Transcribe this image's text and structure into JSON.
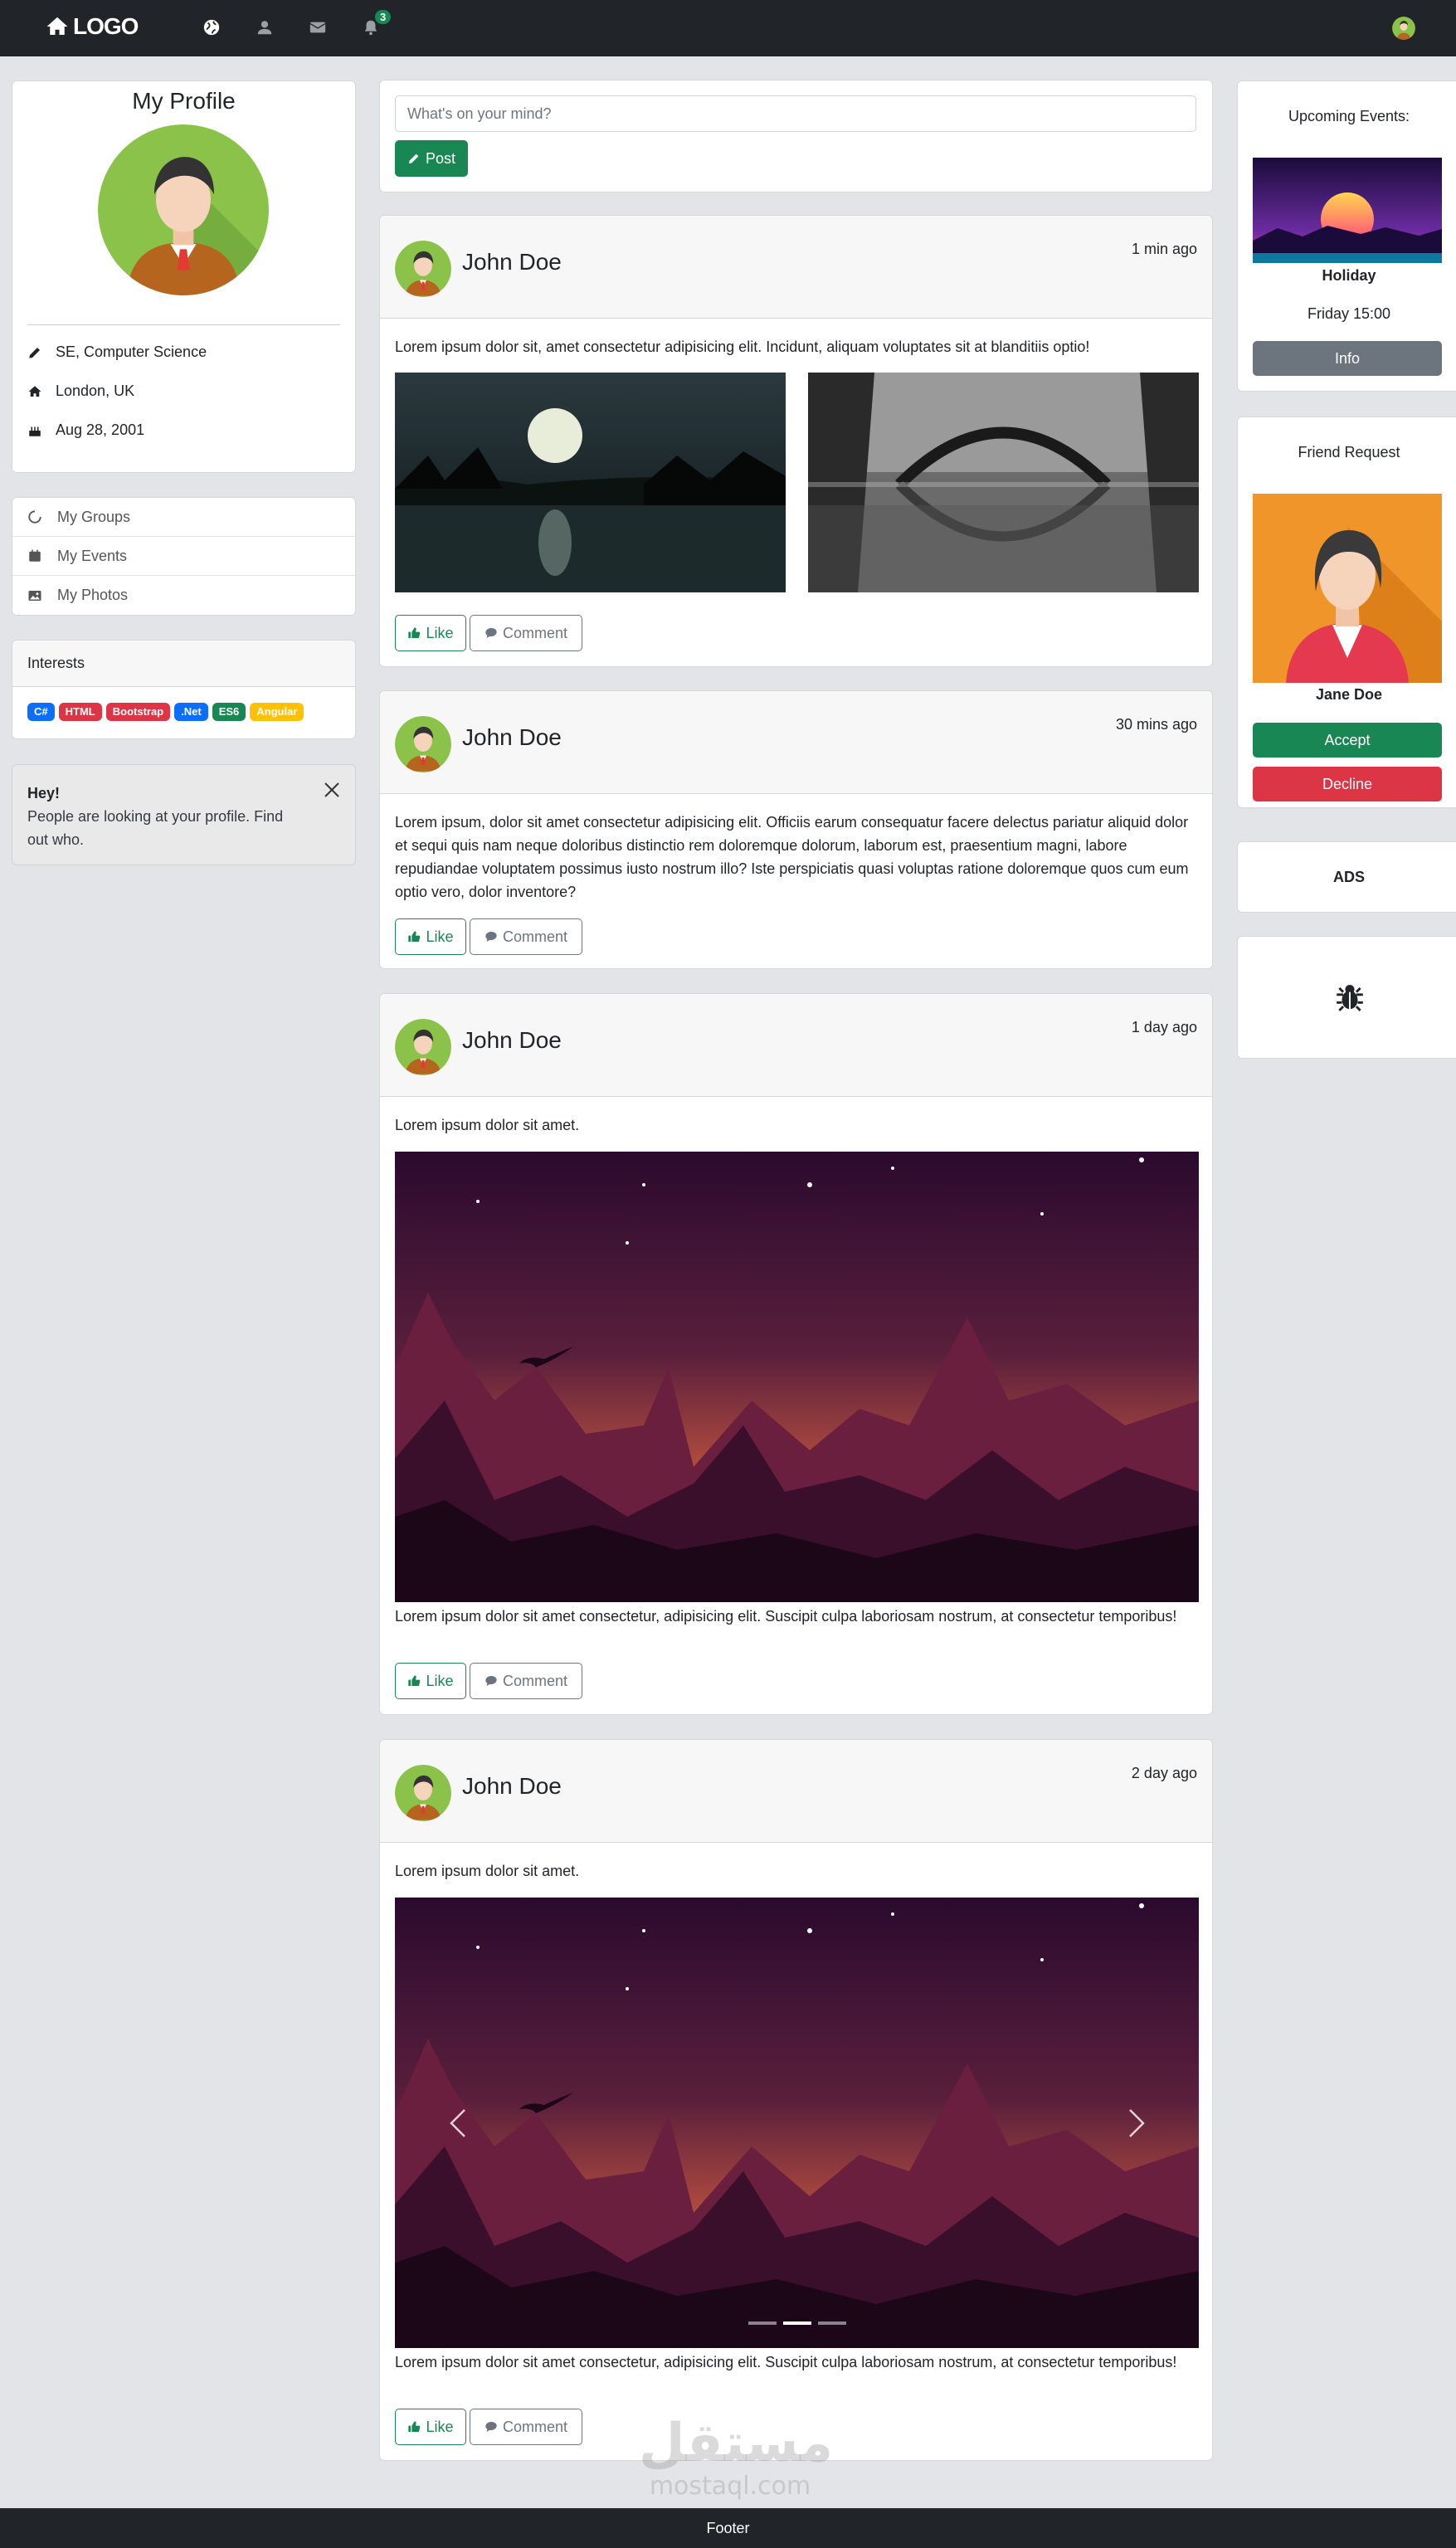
{
  "navbar": {
    "brand": "LOGO",
    "notification_count": "3",
    "icons": [
      "globe-icon",
      "user-icon",
      "envelope-icon",
      "bell-icon"
    ]
  },
  "profile": {
    "title": "My Profile",
    "occupation": "SE, Computer Science",
    "location": "London, UK",
    "birthday": "Aug 28, 2001"
  },
  "links": [
    {
      "label": "My Groups",
      "icon": "circle-notch-icon"
    },
    {
      "label": "My Events",
      "icon": "calendar-icon"
    },
    {
      "label": "My Photos",
      "icon": "image-icon"
    }
  ],
  "interests": {
    "title": "Interests",
    "tags": [
      {
        "label": "C#",
        "color": "#0d6efd"
      },
      {
        "label": "HTML",
        "color": "#dc3545"
      },
      {
        "label": "Bootstrap",
        "color": "#dc3545"
      },
      {
        "label": ".Net",
        "color": "#0d6efd"
      },
      {
        "label": "ES6",
        "color": "#198754"
      },
      {
        "label": "Angular",
        "color": "#ffc107"
      }
    ]
  },
  "alert": {
    "title": "Hey!",
    "message": "People are looking at your profile. Find out who."
  },
  "composer": {
    "placeholder": "What's on your mind?",
    "post_label": "Post"
  },
  "posts": [
    {
      "author": "John Doe",
      "time": "1 min ago",
      "text": "Lorem ipsum dolor sit, amet consectetur adipisicing elit. Incidunt, aliquam voluptates sit at blanditiis optio!",
      "like_label": "Like",
      "comment_label": "Comment"
    },
    {
      "author": "John Doe",
      "time": "30 mins ago",
      "text": "Lorem ipsum, dolor sit amet consectetur adipisicing elit. Officiis earum consequatur facere delectus pariatur aliquid dolor et sequi quis nam neque doloribus distinctio rem doloremque dolorum, laborum est, praesentium magni, labore repudiandae voluptatem possimus iusto nostrum illo? Iste perspiciatis quasi voluptas ratione doloremque quos cum eum optio vero, dolor inventore?",
      "like_label": "Like",
      "comment_label": "Comment"
    },
    {
      "author": "John Doe",
      "time": "1 day ago",
      "text": "Lorem ipsum dolor sit amet.",
      "caption": "Lorem ipsum dolor sit amet consectetur, adipisicing elit. Suscipit culpa laboriosam nostrum, at consectetur temporibus!",
      "like_label": "Like",
      "comment_label": "Comment"
    },
    {
      "author": "John Doe",
      "time": "2 day ago",
      "text": "Lorem ipsum dolor sit amet.",
      "caption": "Lorem ipsum dolor sit amet consectetur, adipisicing elit. Suscipit culpa laboriosam nostrum, at consectetur temporibus!",
      "like_label": "Like",
      "comment_label": "Comment",
      "carousel": {
        "slides": 3,
        "active": 2
      }
    }
  ],
  "events": {
    "title": "Upcoming Events:",
    "name": "Holiday",
    "time": "Friday 15:00",
    "button": "Info"
  },
  "friend_request": {
    "title": "Friend Request",
    "name": "Jane Doe",
    "accept": "Accept",
    "decline": "Decline"
  },
  "ads": {
    "label": "ADS",
    "icon": "bug-icon"
  },
  "footer": {
    "label": "Footer"
  },
  "watermark": {
    "arabic": "مستقل",
    "latin": "mostaql.com"
  },
  "colors": {
    "navbar": "#212529",
    "success": "#198754",
    "danger": "#dc3545",
    "secondary": "#6c757d",
    "page_bg": "#e3e4e8"
  }
}
